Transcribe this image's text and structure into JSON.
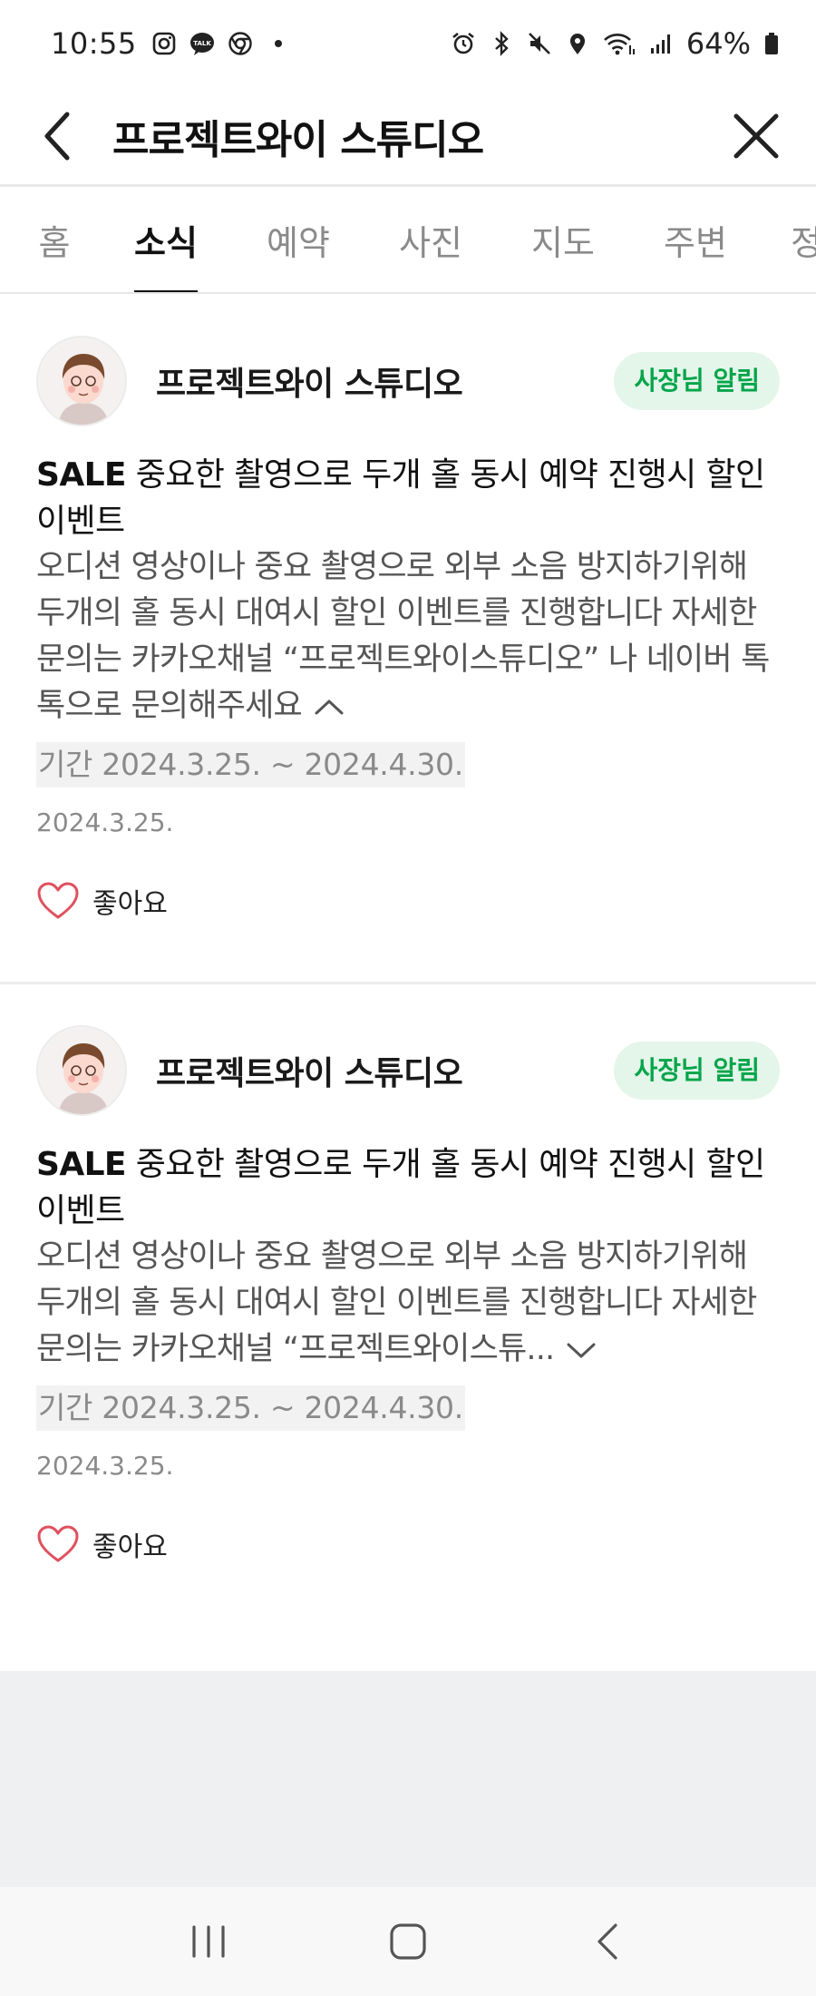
{
  "status_bar": {
    "time": "10:55",
    "battery": "64%",
    "left_icons": [
      "instagram-icon",
      "kakaotalk-icon",
      "chrome-icon",
      "dot-icon"
    ],
    "right_icons": [
      "alarm-icon",
      "bluetooth-icon",
      "mute-icon",
      "location-icon",
      "wifi-icon",
      "signal-icon",
      "battery-icon"
    ]
  },
  "header": {
    "title": "프로젝트와이 스튜디오"
  },
  "tabs": [
    {
      "label": "홈",
      "active": false
    },
    {
      "label": "소식",
      "active": true
    },
    {
      "label": "예약",
      "active": false
    },
    {
      "label": "사진",
      "active": false
    },
    {
      "label": "지도",
      "active": false
    },
    {
      "label": "주변",
      "active": false
    },
    {
      "label": "정",
      "active": false
    }
  ],
  "posts": [
    {
      "author": "프로젝트와이 스튜디오",
      "badge": "사장님 알림",
      "title_prefix": "SALE",
      "title_text": " 중요한 촬영으로 두개 홀 동시 예약 진행시 할인 이벤트",
      "body": "오디션 영상이나 중요 촬영으로 외부 소음 방지하기위해 두개의 홀 동시 대여시 할인 이벤트를 진행합니다 자세한 문의는 카카오채널 “프로젝트와이스튜디오” 나 네이버 톡톡으로 문의해주세요",
      "expanded": true,
      "period": "기간 2024.3.25. ~ 2024.4.30.",
      "date": "2024.3.25.",
      "like_label": "좋아요"
    },
    {
      "author": "프로젝트와이 스튜디오",
      "badge": "사장님 알림",
      "title_prefix": "SALE",
      "title_text": " 중요한 촬영으로 두개 홀 동시 예약 진행시 할인 이벤트",
      "body": "오디션 영상이나 중요 촬영으로 외부 소음 방지하기위해 두개의 홀 동시 대여시 할인 이벤트를 진행합니다 자세한 문의는 카카오채널 “프로젝트와이스튜...",
      "expanded": false,
      "period": "기간 2024.3.25. ~ 2024.4.30.",
      "date": "2024.3.25.",
      "like_label": "좋아요"
    }
  ],
  "colors": {
    "badge_bg": "#e4f5ea",
    "badge_text": "#04a54a",
    "like_heart": "#e0505e",
    "active_tab": "#111111"
  },
  "navbar": [
    "recent-apps-icon",
    "home-icon",
    "back-icon"
  ]
}
